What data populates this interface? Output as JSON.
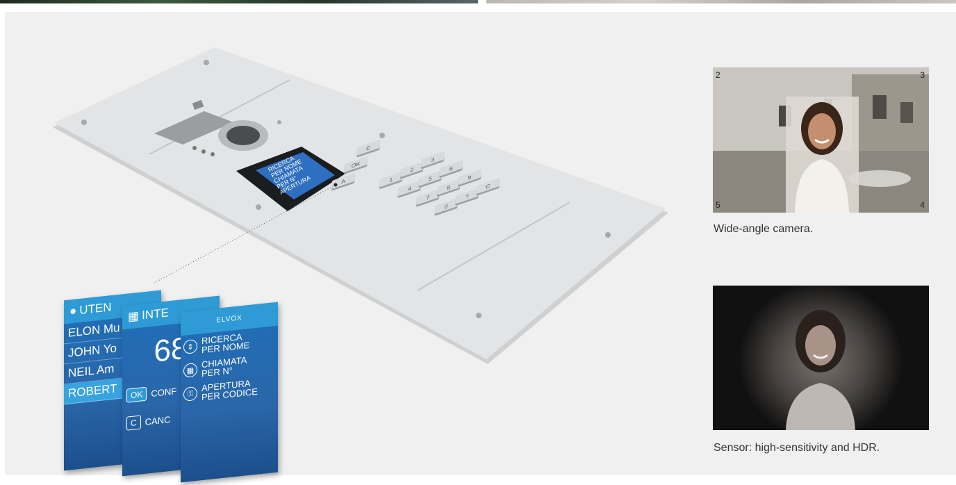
{
  "device": {
    "lcd_lines": [
      "RICERCA",
      "PER NOME",
      "CHIAMATA",
      "PER N°",
      "APERTURA",
      "PER CODICE"
    ],
    "keys": [
      "A",
      "OK",
      "C",
      "1",
      "2",
      "3",
      "4",
      "5",
      "6",
      "7",
      "8",
      "9",
      "0",
      "?",
      "C"
    ]
  },
  "cards": {
    "card1": {
      "header": "UTEN",
      "rows": [
        "ELON Mu",
        "JOHN Yo",
        "NEIL Am",
        "ROBERT"
      ]
    },
    "card2": {
      "header": "INTE",
      "number": "68",
      "ok_key": "OK",
      "ok_label": "CONF",
      "c_key": "C",
      "c_label": "CANC"
    },
    "card3": {
      "header": "ELVOX",
      "items": [
        {
          "line1": "RICERCA",
          "line2": "PER NOME"
        },
        {
          "line1": "CHIAMATA",
          "line2": "PER N°"
        },
        {
          "line1": "APERTURA",
          "line2": "PER CODICE"
        }
      ]
    }
  },
  "photos": {
    "wide_angle": {
      "corners": [
        "2",
        "3",
        "5",
        "4"
      ],
      "caption": "Wide-angle camera."
    },
    "sensor": {
      "caption": "Sensor: high-sensitivity and HDR."
    }
  }
}
